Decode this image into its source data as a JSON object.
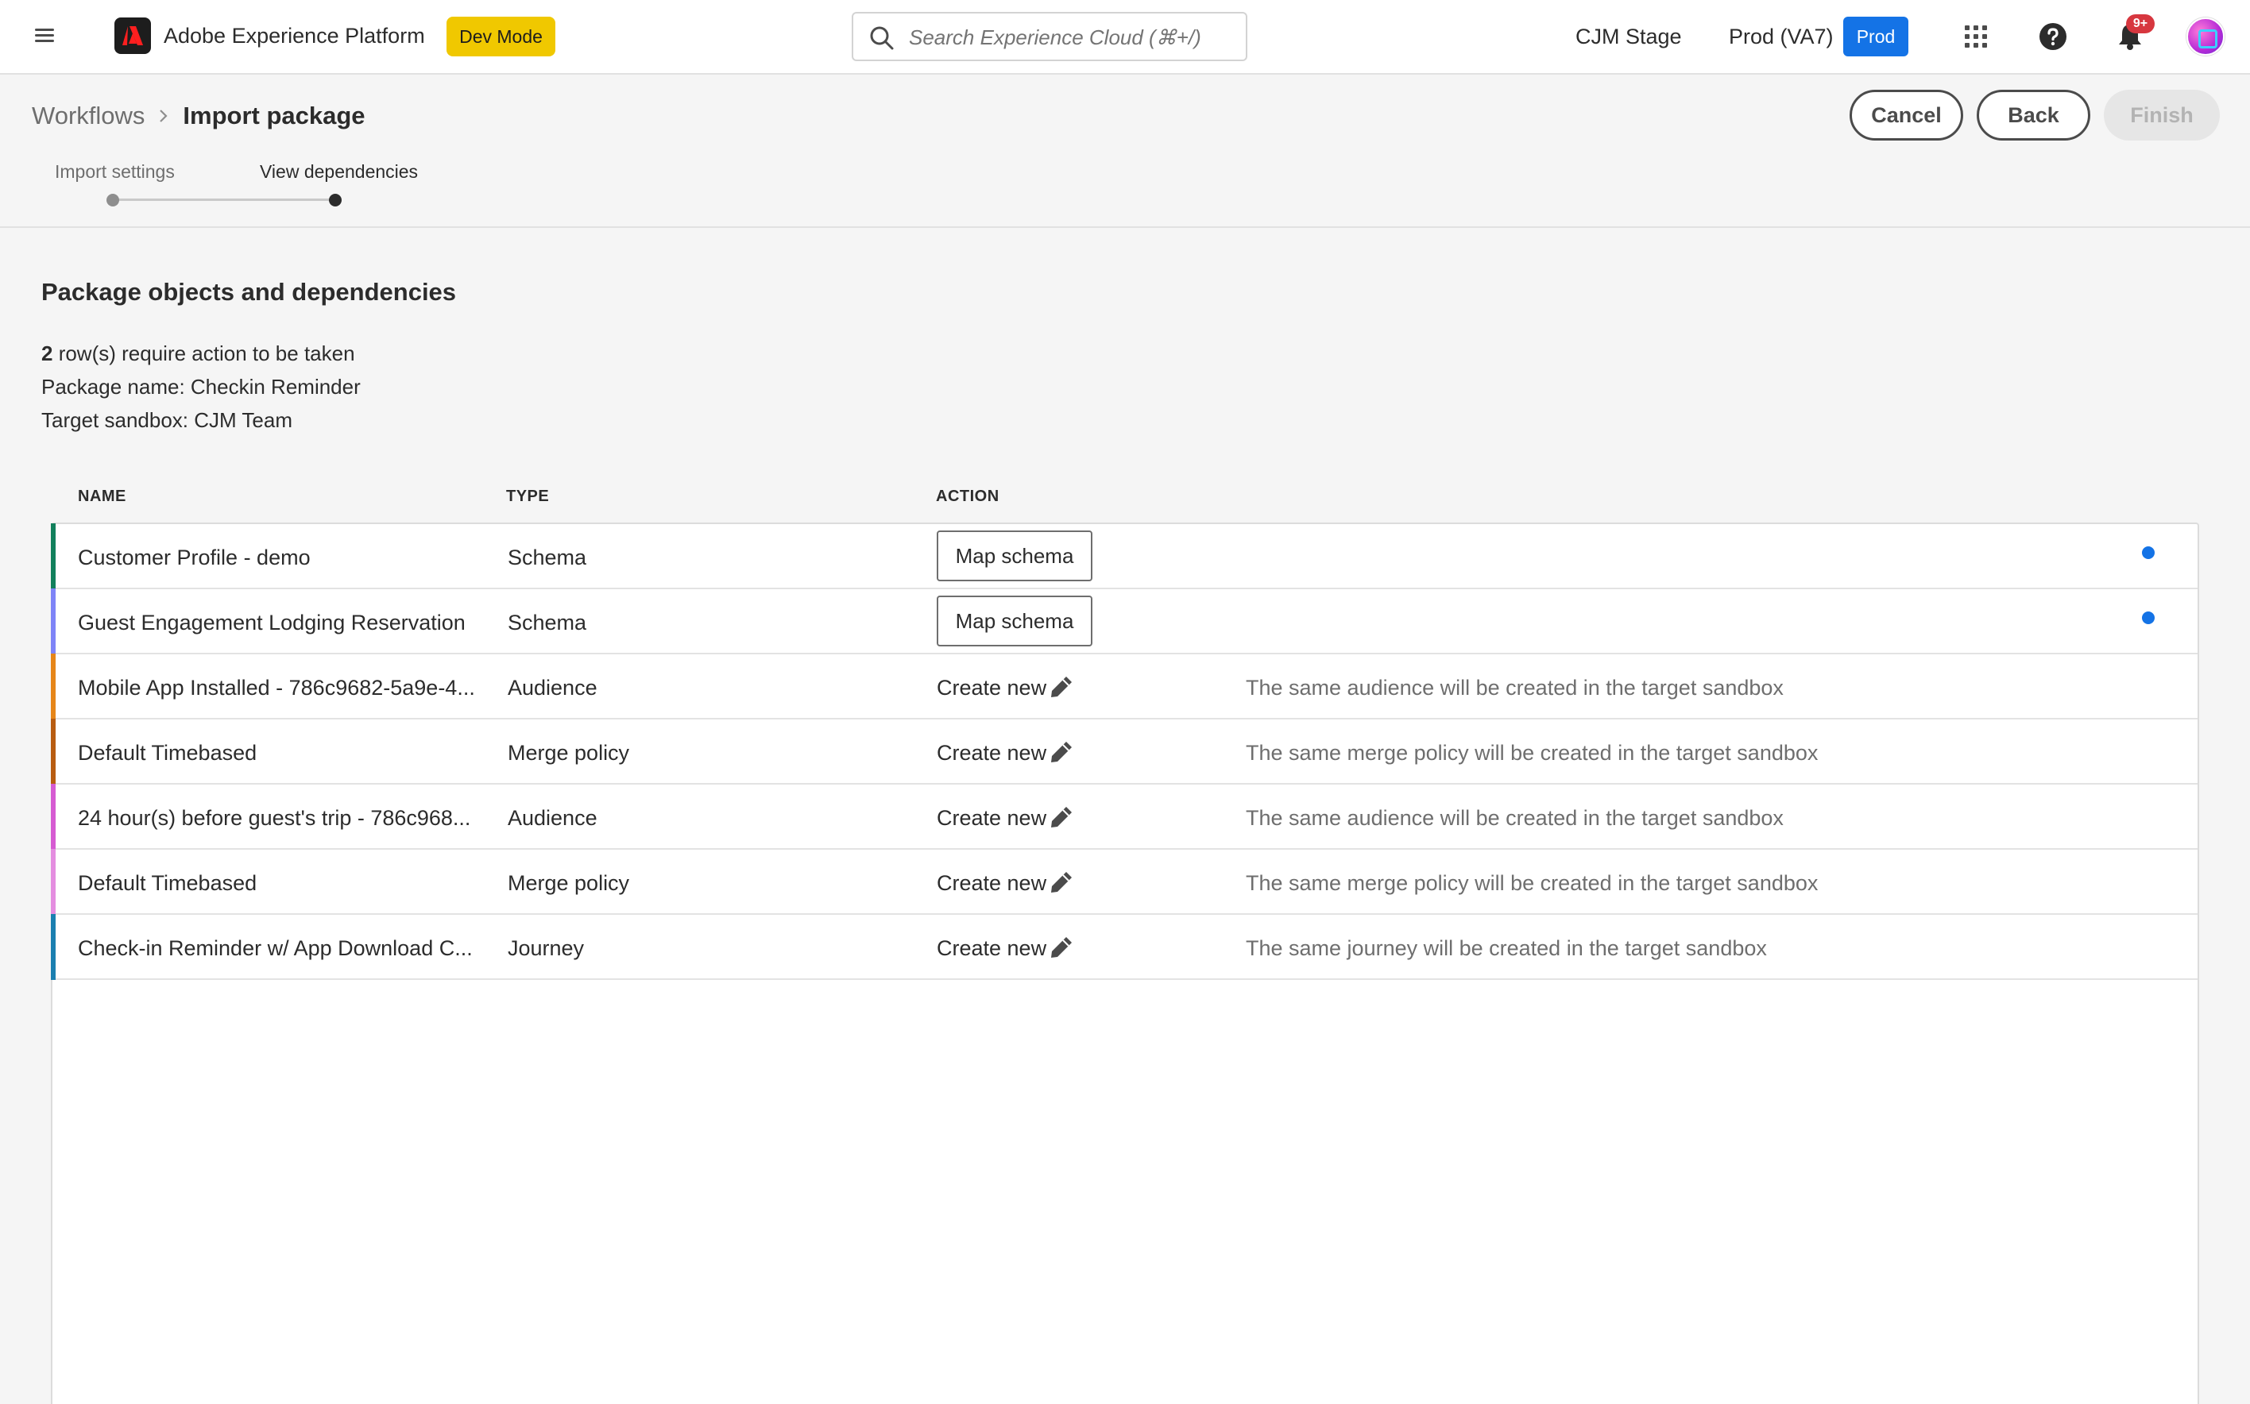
{
  "shell": {
    "app_name": "Adobe Experience Platform",
    "dev_mode_label": "Dev Mode",
    "search_placeholder": "Search Experience Cloud (⌘+/)",
    "org_name": "CJM Stage",
    "sandbox_name": "Prod (VA7)",
    "sandbox_badge": "Prod",
    "notification_count": "9+",
    "brand_color": "#f0c800",
    "accent_color": "#1473e6",
    "badge_color": "#d7373f"
  },
  "page": {
    "breadcrumb_parent": "Workflows",
    "breadcrumb_current": "Import package",
    "cancel_label": "Cancel",
    "back_label": "Back",
    "finish_label": "Finish",
    "steps": [
      {
        "label": "Import settings"
      },
      {
        "label": "View dependencies"
      }
    ]
  },
  "content": {
    "section_title": "Package objects and dependencies",
    "rows_require_action_count": "2",
    "rows_require_action_text": " row(s) require action to be taken",
    "package_name_line": "Package name: Checkin Reminder",
    "target_sandbox_line": "Target sandbox: CJM Team"
  },
  "table": {
    "columns": [
      "NAME",
      "TYPE",
      "ACTION"
    ],
    "rows": [
      {
        "name": "Customer Profile - demo",
        "type": "Schema",
        "action": "Map schema",
        "action_kind": "button",
        "description": "",
        "indicator": true,
        "stripe_color": "#12805c"
      },
      {
        "name": "Guest Engagement Lodging Reservation",
        "type": "Schema",
        "action": "Map schema",
        "action_kind": "button",
        "description": "",
        "indicator": true,
        "stripe_color": "#7e84f7"
      },
      {
        "name": "Mobile App Installed - 786c9682-5a9e-4...",
        "type": "Audience",
        "action": "Create new",
        "action_kind": "edit",
        "description": "The same audience will be created in the target sandbox",
        "indicator": false,
        "stripe_color": "#e68619"
      },
      {
        "name": "Default Timebased",
        "type": "Merge policy",
        "action": "Create new",
        "action_kind": "edit",
        "description": "The same merge policy will be created in the target sandbox",
        "indicator": false,
        "stripe_color": "#b85c11"
      },
      {
        "name": "24 hour(s) before guest's trip - 786c968...",
        "type": "Audience",
        "action": "Create new",
        "action_kind": "edit",
        "description": "The same audience will be created in the target sandbox",
        "indicator": false,
        "stripe_color": "#d65bd2"
      },
      {
        "name": "Default Timebased",
        "type": "Merge policy",
        "action": "Create new",
        "action_kind": "edit",
        "description": "The same merge policy will be created in the target sandbox",
        "indicator": false,
        "stripe_color": "#e48ee0"
      },
      {
        "name": "Check-in Reminder w/ App Download C...",
        "type": "Journey",
        "action": "Create new",
        "action_kind": "edit",
        "description": "The same journey will be created in the target sandbox",
        "indicator": false,
        "stripe_color": "#1b7fb0"
      }
    ]
  }
}
